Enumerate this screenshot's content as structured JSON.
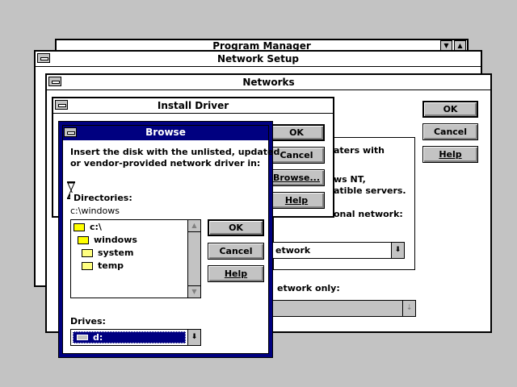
{
  "program_manager": {
    "title": "Program Manager"
  },
  "network_setup": {
    "title": "Network Setup"
  },
  "networks": {
    "title": "Networks",
    "ok_label": "OK",
    "cancel_label": "Cancel",
    "help_label": "Help",
    "partial_text_1": "aters with",
    "partial_text_2": "ws NT,",
    "partial_text_3": "atible servers.",
    "partial_text_4": "onal network:",
    "combo_value": "etwork",
    "partial_text_5": "etwork only:"
  },
  "install_driver": {
    "title": "Install Driver",
    "ok_label": "OK",
    "cancel_label": "Cancel",
    "browse_label": "Browse...",
    "help_label": "Help"
  },
  "browse": {
    "title": "Browse",
    "instructions_line1": "Insert the disk with the unlisted, updated,",
    "instructions_line2": "or vendor-provided network driver in:",
    "directories_label": "Directories:",
    "current_path": "c:\\windows",
    "directory_items": [
      {
        "label": "c:\\",
        "icon": "open-folder"
      },
      {
        "label": "windows",
        "icon": "open-folder"
      },
      {
        "label": "system",
        "icon": "folder"
      },
      {
        "label": "temp",
        "icon": "folder"
      }
    ],
    "ok_label": "OK",
    "cancel_label": "Cancel",
    "help_label": "Help",
    "drives_label": "Drives:",
    "drive_value": "d:"
  }
}
